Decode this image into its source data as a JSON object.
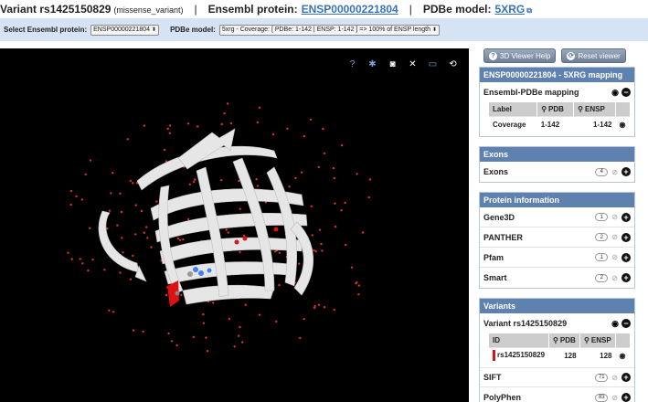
{
  "header": {
    "variant_label": "Variant rs1425150829",
    "variant_type": "(missense_variant)",
    "ensembl_label": "Ensembl protein:",
    "ensembl_link": "ENSP00000221804",
    "pdbe_label": "PDBe model:",
    "pdbe_link": "5XRG",
    "separator": "|"
  },
  "selbar": {
    "protein_label": "Select Ensembl protein:",
    "protein_value": "ENSP00000221804",
    "model_label": "PDBe model:",
    "model_value": "5xrg - Coverage: [ PDBe: 1-142 | ENSP: 1-142 ] => 100% of ENSP length"
  },
  "viewer": {
    "toolbar_icons": [
      "help-icon",
      "gear-icon",
      "camera-icon",
      "tools-icon",
      "fullscreen-icon",
      "expand-icon"
    ]
  },
  "panel": {
    "help_button": "3D Viewer Help",
    "reset_button": "Reset viewer",
    "mapping": {
      "title": "ENSP00000221804 - 5XRG mapping",
      "sub": "Ensembl-PDBe mapping",
      "columns": [
        "Label",
        "PDB",
        "ENSP"
      ],
      "row": {
        "label": "Coverage",
        "pdb": "1-142",
        "ensp": "1-142"
      }
    },
    "exons": {
      "title": "Exons",
      "items": [
        {
          "label": "Exons",
          "count": "4"
        }
      ]
    },
    "protein": {
      "title": "Protein information",
      "items": [
        {
          "label": "Gene3D",
          "count": "1"
        },
        {
          "label": "PANTHER",
          "count": "2"
        },
        {
          "label": "Pfam",
          "count": "1"
        },
        {
          "label": "Smart",
          "count": "2"
        }
      ]
    },
    "variants": {
      "title": "Variants",
      "sub": "Variant rs1425150829",
      "columns": [
        "ID",
        "PDB",
        "ENSP"
      ],
      "row": {
        "id": "rs1425150829",
        "pdb": "128",
        "ensp": "128"
      },
      "items": [
        {
          "label": "SIFT",
          "count": "71"
        },
        {
          "label": "PolyPhen",
          "count": "83"
        }
      ]
    }
  },
  "colors": {
    "accent": "#5e81b0",
    "selbar_bg": "#d6e3f4",
    "link": "#3a73b9",
    "variant_red": "#dd1111"
  }
}
